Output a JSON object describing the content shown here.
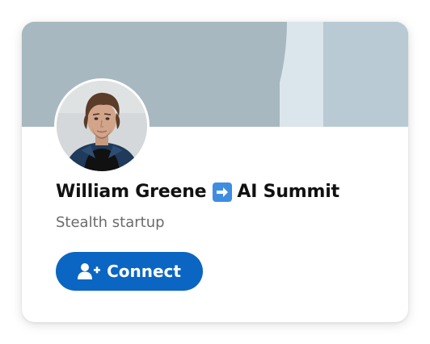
{
  "profile": {
    "name": "William Greene",
    "event": "AI Summit",
    "subtitle": "Stealth startup",
    "avatar_alt": "profile photo"
  },
  "actions": {
    "connect_label": "Connect"
  },
  "icons": {
    "arrow": "right-arrow-icon",
    "connect": "add-person-icon"
  },
  "colors": {
    "accent": "#0a66c2",
    "banner": "#a8b8c0",
    "arrow_box": "#3f8de0"
  }
}
